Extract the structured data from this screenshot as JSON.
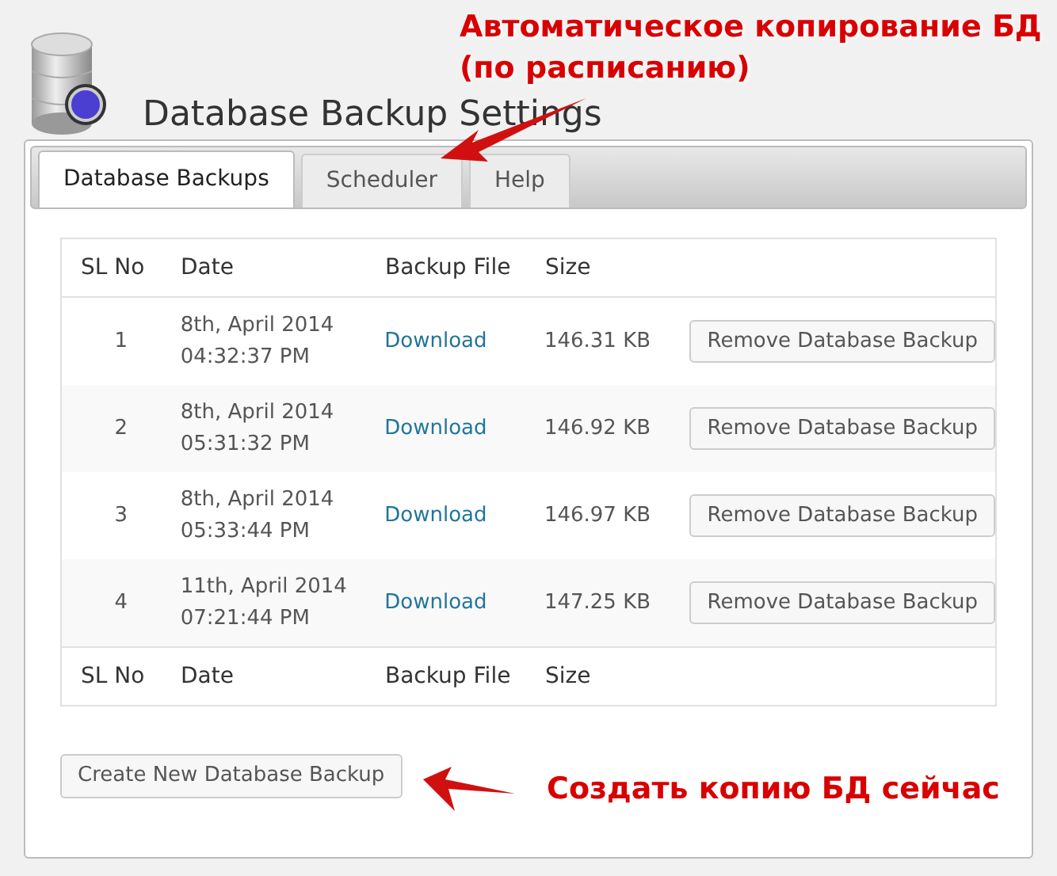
{
  "page_title": "Database Backup Settings",
  "annotations": [
    {
      "kind": "top",
      "text": "Автоматическое копирование БД (по расписанию)"
    },
    {
      "kind": "bottom",
      "text": "Создать копию БД сейчас"
    }
  ],
  "tabs": [
    {
      "label": "Database Backups",
      "selected": true
    },
    {
      "label": "Scheduler",
      "selected": false
    },
    {
      "label": "Help",
      "selected": false
    }
  ],
  "table": {
    "columns": [
      "SL No",
      "Date",
      "Backup File",
      "Size"
    ],
    "rows": [
      {
        "sl": "1",
        "date": "8th, April 2014",
        "time": "04:32:37 PM",
        "file": "Download",
        "size": "146.31 KB",
        "action": "Remove Database Backup"
      },
      {
        "sl": "2",
        "date": "8th, April 2014",
        "time": "05:31:32 PM",
        "file": "Download",
        "size": "146.92 KB",
        "action": "Remove Database Backup"
      },
      {
        "sl": "3",
        "date": "8th, April 2014",
        "time": "05:33:44 PM",
        "file": "Download",
        "size": "146.97 KB",
        "action": "Remove Database Backup"
      },
      {
        "sl": "4",
        "date": "11th, April 2014",
        "time": "07:21:44 PM",
        "file": "Download",
        "size": "147.25 KB",
        "action": "Remove Database Backup"
      }
    ],
    "footer_columns": [
      "SL No",
      "Date",
      "Backup File",
      "Size"
    ]
  },
  "create_button": "Create New Database Backup"
}
